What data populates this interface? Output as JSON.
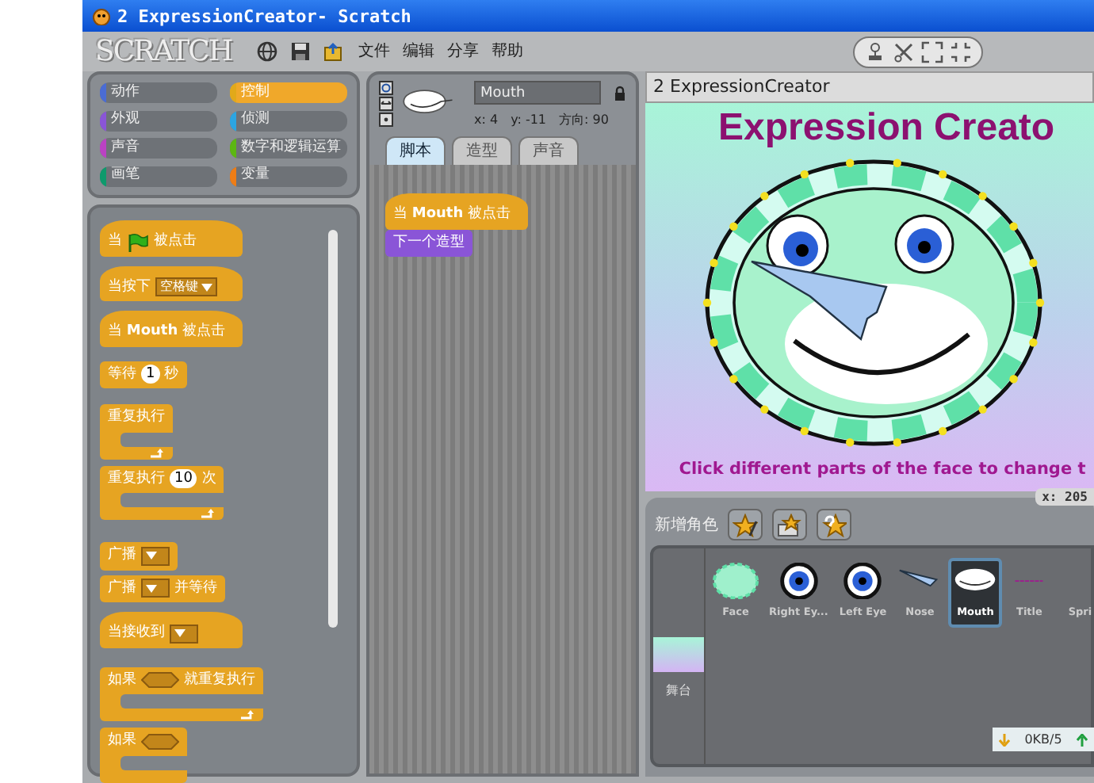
{
  "window": {
    "title": "2 ExpressionCreator- Scratch"
  },
  "menu_bar": {
    "logo": "SCRATCH",
    "menus": [
      "文件",
      "编辑",
      "分享",
      "帮助"
    ]
  },
  "categories": [
    {
      "label": "动作",
      "color": "#4a6cd4",
      "selected": false
    },
    {
      "label": "控制",
      "color": "#e1a91a",
      "selected": true
    },
    {
      "label": "外观",
      "color": "#8a55d7",
      "selected": false
    },
    {
      "label": "侦测",
      "color": "#2ca5e2",
      "selected": false
    },
    {
      "label": "声音",
      "color": "#bb42c3",
      "selected": false
    },
    {
      "label": "数字和逻辑运算",
      "color": "#5cb712",
      "selected": false
    },
    {
      "label": "画笔",
      "color": "#0e9a6c",
      "selected": false
    },
    {
      "label": "变量",
      "color": "#ee7d16",
      "selected": false
    }
  ],
  "palette": [
    {
      "kind": "hat",
      "color": "#e6a422",
      "parts": [
        {
          "kind": "text",
          "text": "当"
        },
        {
          "kind": "flag"
        },
        {
          "kind": "text",
          "text": "被点击"
        }
      ]
    },
    {
      "kind": "hat",
      "color": "#e6a422",
      "parts": [
        {
          "kind": "text",
          "text": "当按下"
        },
        {
          "kind": "dropdown",
          "value": "空格键"
        }
      ]
    },
    {
      "kind": "hat",
      "color": "#e6a422",
      "parts": [
        {
          "kind": "text",
          "text": "当 **Mouth** 被点击"
        }
      ]
    },
    {
      "kind": "command",
      "color": "#e6a422",
      "parts": [
        {
          "kind": "text",
          "text": "等待"
        },
        {
          "kind": "number",
          "value": "1"
        },
        {
          "kind": "text",
          "text": "秒"
        }
      ]
    },
    {
      "kind": "c",
      "loop": true,
      "color": "#e6a422",
      "parts": [
        {
          "kind": "text",
          "text": "重复执行"
        }
      ]
    },
    {
      "kind": "c",
      "loop": true,
      "color": "#e6a422",
      "parts": [
        {
          "kind": "text",
          "text": "重复执行"
        },
        {
          "kind": "number",
          "value": "10"
        },
        {
          "kind": "text",
          "text": "次"
        }
      ]
    },
    {
      "kind": "command",
      "color": "#e6a422",
      "parts": [
        {
          "kind": "text",
          "text": "广播"
        },
        {
          "kind": "dropdown"
        }
      ]
    },
    {
      "kind": "command",
      "color": "#e6a422",
      "parts": [
        {
          "kind": "text",
          "text": "广播"
        },
        {
          "kind": "dropdown"
        },
        {
          "kind": "text",
          "text": "并等待"
        }
      ]
    },
    {
      "kind": "hat",
      "color": "#e6a422",
      "parts": [
        {
          "kind": "text",
          "text": "当接收到"
        },
        {
          "kind": "dropdown"
        }
      ]
    },
    {
      "kind": "c",
      "loop": true,
      "color": "#e6a422",
      "parts": [
        {
          "kind": "text",
          "text": "如果"
        },
        {
          "kind": "bool"
        },
        {
          "kind": "text",
          "text": "就重复执行"
        }
      ]
    },
    {
      "kind": "c",
      "loop": false,
      "color": "#e6a422",
      "parts": [
        {
          "kind": "text",
          "text": "如果"
        },
        {
          "kind": "bool"
        }
      ]
    }
  ],
  "sprite_info": {
    "name": "Mouth",
    "x": "x: 4",
    "y": "y: -11",
    "direction": "方向: 90"
  },
  "tabs": [
    {
      "label": "脚本",
      "selected": true
    },
    {
      "label": "造型",
      "selected": false
    },
    {
      "label": "声音",
      "selected": false
    }
  ],
  "scripts": [
    {
      "kind": "hat",
      "color": "#e6a422",
      "parts": [
        {
          "kind": "text",
          "text": "当 **Mouth** 被点击"
        }
      ]
    },
    {
      "kind": "command",
      "color": "#8a55d7",
      "parts": [
        {
          "kind": "text",
          "text": "下一个造型"
        }
      ]
    }
  ],
  "stage": {
    "title": "2 ExpressionCreator",
    "heading": "Expression Creato",
    "caption": "Click different parts of the face to change t",
    "mouse_readout": "x: 205"
  },
  "sprite_pane": {
    "label": "新增角色",
    "stage_label": "舞台",
    "status": "0KB/5",
    "sprites": [
      {
        "name": "Face",
        "kind": "face",
        "selected": false
      },
      {
        "name": "Right Ey...",
        "kind": "eye",
        "selected": false
      },
      {
        "name": "Left Eye",
        "kind": "eye",
        "selected": false
      },
      {
        "name": "Nose",
        "kind": "nose",
        "selected": false
      },
      {
        "name": "Mouth",
        "kind": "mouth",
        "selected": true
      },
      {
        "name": "Title",
        "kind": "title",
        "selected": false
      },
      {
        "name": "Spri",
        "kind": "other",
        "selected": false
      }
    ]
  }
}
